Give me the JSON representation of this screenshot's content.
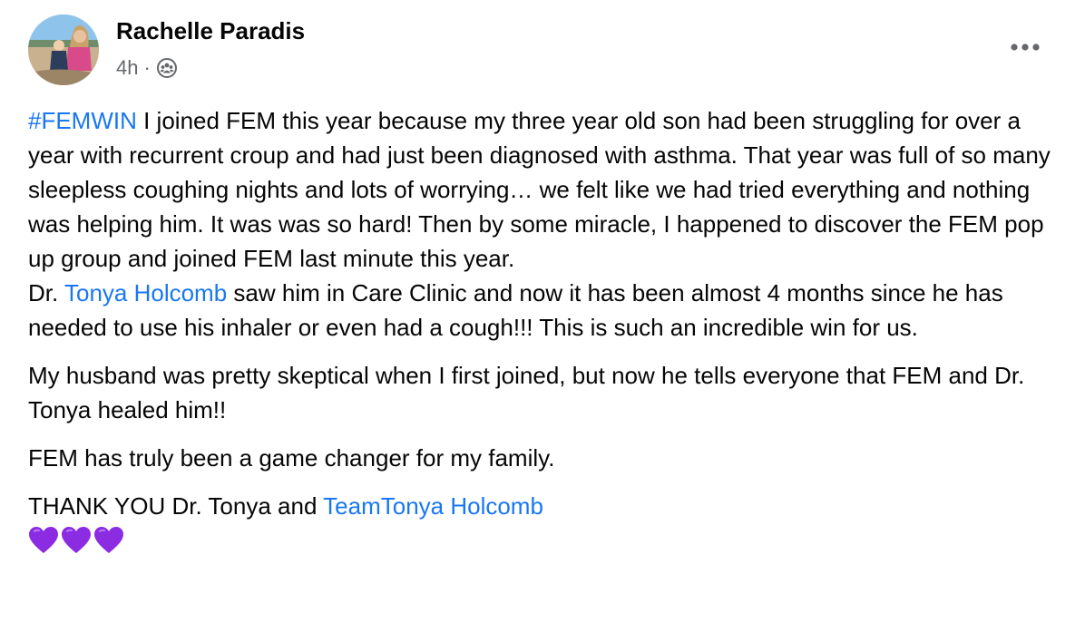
{
  "post": {
    "author": "Rachelle Paradis",
    "time": "4h",
    "separator": "·",
    "audience_icon": "group-audience-icon",
    "more_icon": "more-options-icon",
    "link_color": "#1877f2",
    "heart_color": "#8b2be2",
    "paragraph1": {
      "hashtag": "#FEMWIN",
      "text1": " I joined FEM this year because my three year old son had been struggling for over a year with recurrent croup and had just been diagnosed with asthma. That year was full of so many sleepless coughing nights and lots of worrying… we felt like we had tried everything and nothing was helping him. It was was so hard! Then by some miracle, I happened to discover the FEM pop up group and joined FEM last minute this year.",
      "text2_prefix": "Dr. ",
      "mention1": "Tonya Holcomb",
      "text2_suffix": " saw him in Care Clinic and now it has been almost 4 months since he has needed to use his inhaler or even had a cough!!! This is such an incredible win for us."
    },
    "paragraph2": "My husband was pretty skeptical when I first joined, but now he tells everyone that FEM and Dr. Tonya healed him!!",
    "paragraph3": "FEM has truly been a game changer for my family.",
    "paragraph4": {
      "prefix": "THANK YOU Dr. Tonya and ",
      "mention2": "TeamTonya Holcomb"
    },
    "emoji_icons": [
      "purple-heart-icon",
      "purple-heart-icon",
      "purple-heart-icon"
    ]
  }
}
